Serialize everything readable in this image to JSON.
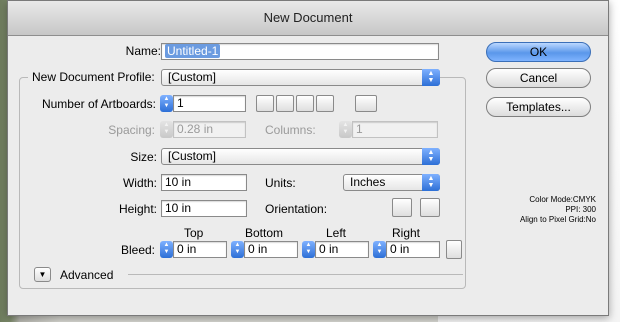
{
  "dialog": {
    "title": "New Document",
    "name_label": "Name:",
    "name_value": "Untitled-1",
    "profile_label": "New Document Profile:",
    "profile_value": "[Custom]",
    "artboards_label": "Number of Artboards:",
    "artboards_value": "1",
    "spacing_label": "Spacing:",
    "spacing_value": "0.28 in",
    "columns_label": "Columns:",
    "columns_value": "1",
    "size_label": "Size:",
    "size_value": "[Custom]",
    "width_label": "Width:",
    "width_value": "10 in",
    "units_label": "Units:",
    "units_value": "Inches",
    "height_label": "Height:",
    "height_value": "10 in",
    "orientation_label": "Orientation:",
    "bleed_label": "Bleed:",
    "bleed": {
      "top_label": "Top",
      "top_value": "0 in",
      "bottom_label": "Bottom",
      "bottom_value": "0 in",
      "left_label": "Left",
      "left_value": "0 in",
      "right_label": "Right",
      "right_value": "0 in"
    },
    "advanced_label": "Advanced",
    "buttons": {
      "ok": "OK",
      "cancel": "Cancel",
      "templates": "Templates..."
    },
    "info": {
      "color_mode": "Color Mode:CMYK",
      "ppi": "PPI: 300",
      "align": "Align to Pixel Grid:No"
    }
  }
}
